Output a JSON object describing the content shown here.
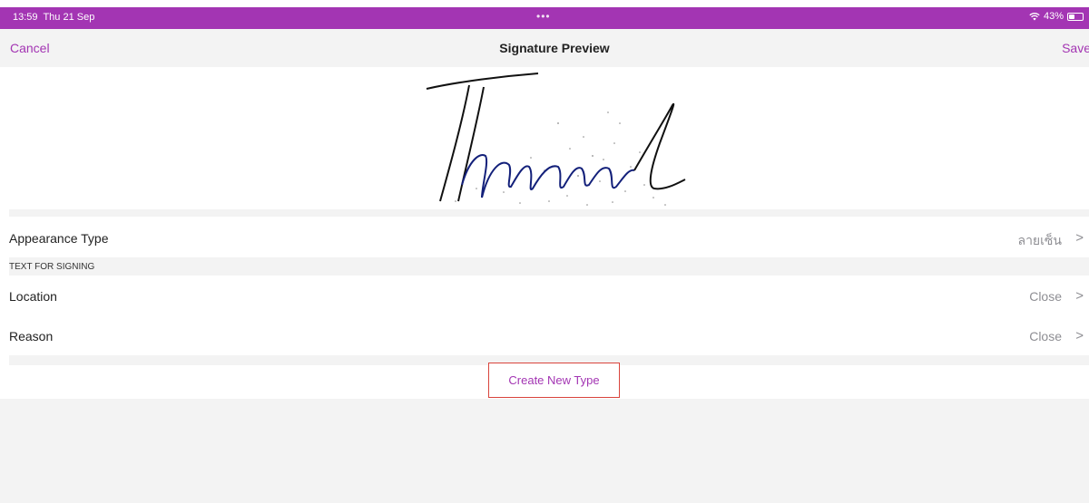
{
  "status_bar": {
    "time": "13:59",
    "date": "Thu 21 Sep",
    "dots": "•••",
    "battery_percent": "43%",
    "battery_level": 0.43
  },
  "nav": {
    "cancel_label": "Cancel",
    "title": "Signature Preview",
    "save_label": "Save"
  },
  "signature": {
    "handwritten_text": "Thanawal"
  },
  "appearance": {
    "label": "Appearance Type",
    "value": "ลายเซ็น"
  },
  "section_header": "TEXT FOR SIGNING",
  "location": {
    "label": "Location",
    "value": "Close"
  },
  "reason": {
    "label": "Reason",
    "value": "Close"
  },
  "create_button_label": "Create New Type",
  "colors": {
    "accent": "#a335b3",
    "highlight_border": "#d9443c",
    "background_gray": "#f3f3f3",
    "secondary_text": "#8e8e93"
  }
}
